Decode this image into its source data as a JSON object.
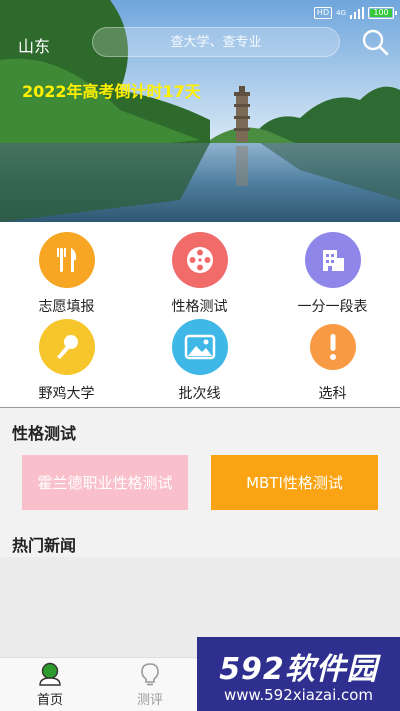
{
  "status_bar": {
    "hd": "HD",
    "network": "4G",
    "battery": "100"
  },
  "header": {
    "province": "山东",
    "search_placeholder": "查大学、查专业",
    "countdown": "2022年高考倒计时17天"
  },
  "menu": {
    "items": [
      {
        "label": "志愿填报",
        "icon": "utensils-icon",
        "color": "#f6a623"
      },
      {
        "label": "性格测试",
        "icon": "film-reel-icon",
        "color": "#f26b6b"
      },
      {
        "label": "一分一段表",
        "icon": "building-icon",
        "color": "#8f86ea"
      },
      {
        "label": "野鸡大学",
        "icon": "microphone-icon",
        "color": "#f7c62d"
      },
      {
        "label": "批次线",
        "icon": "image-icon",
        "color": "#3fb8e8"
      },
      {
        "label": "选科",
        "icon": "exclamation-icon",
        "color": "#f79a43"
      }
    ]
  },
  "personality": {
    "title": "性格测试",
    "holland_label": "霍兰德职业性格测试",
    "mbti_label": "MBTI性格测试",
    "holland_color": "#f9c0cc",
    "mbti_color": "#fba413"
  },
  "news": {
    "title": "热门新闻"
  },
  "tabbar": {
    "home_label": "首页",
    "review_label": "测评",
    "active_color": "#2c9a2c"
  },
  "watermark": {
    "logo_num": "592",
    "logo_text": "软件园",
    "url": "www.592xiazai.com"
  }
}
